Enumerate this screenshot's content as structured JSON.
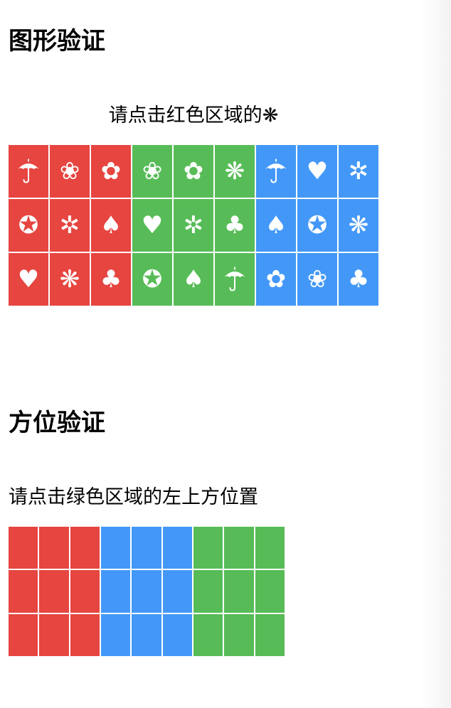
{
  "colors": {
    "red": "#e64540",
    "green": "#57bc57",
    "blue": "#4398f7",
    "glyph": "#ffffff"
  },
  "graphic_verify": {
    "title": "图形验证",
    "prompt_text": "请点击红色区域的",
    "prompt_symbol": "❋",
    "rows": [
      [
        {
          "color": "red",
          "icon": "umbrella-icon",
          "glyph": "☂"
        },
        {
          "color": "red",
          "icon": "flower-icon",
          "glyph": "❀"
        },
        {
          "color": "red",
          "icon": "florette-icon",
          "glyph": "✿"
        },
        {
          "color": "green",
          "icon": "flower-icon",
          "glyph": "❀"
        },
        {
          "color": "green",
          "icon": "florette-icon",
          "glyph": "✿"
        },
        {
          "color": "green",
          "icon": "propeller-asterisk-icon",
          "glyph": "❋"
        },
        {
          "color": "blue",
          "icon": "umbrella-icon",
          "glyph": "☂"
        },
        {
          "color": "blue",
          "icon": "heart-icon",
          "glyph": "♥"
        },
        {
          "color": "blue",
          "icon": "teardrop-asterisk-icon",
          "glyph": "✲"
        }
      ],
      [
        {
          "color": "red",
          "icon": "circled-star-icon",
          "glyph": "✪"
        },
        {
          "color": "red",
          "icon": "teardrop-asterisk-icon",
          "glyph": "✲"
        },
        {
          "color": "red",
          "icon": "spade-icon",
          "glyph": "♠"
        },
        {
          "color": "green",
          "icon": "heart-icon",
          "glyph": "♥"
        },
        {
          "color": "green",
          "icon": "teardrop-asterisk-icon",
          "glyph": "✲"
        },
        {
          "color": "green",
          "icon": "club-icon",
          "glyph": "♣"
        },
        {
          "color": "blue",
          "icon": "spade-icon",
          "glyph": "♠"
        },
        {
          "color": "blue",
          "icon": "circled-star-icon",
          "glyph": "✪"
        },
        {
          "color": "blue",
          "icon": "propeller-asterisk-icon",
          "glyph": "❋"
        }
      ],
      [
        {
          "color": "red",
          "icon": "heart-icon",
          "glyph": "♥"
        },
        {
          "color": "red",
          "icon": "propeller-asterisk-icon",
          "glyph": "❋"
        },
        {
          "color": "red",
          "icon": "club-icon",
          "glyph": "♣"
        },
        {
          "color": "green",
          "icon": "circled-star-icon",
          "glyph": "✪"
        },
        {
          "color": "green",
          "icon": "spade-icon",
          "glyph": "♠"
        },
        {
          "color": "green",
          "icon": "umbrella-icon",
          "glyph": "☂"
        },
        {
          "color": "blue",
          "icon": "florette-icon",
          "glyph": "✿"
        },
        {
          "color": "blue",
          "icon": "flower-icon",
          "glyph": "❀"
        },
        {
          "color": "blue",
          "icon": "club-icon",
          "glyph": "♣"
        }
      ]
    ]
  },
  "position_verify": {
    "title": "方位验证",
    "prompt": "请点击绿色区域的左上方位置",
    "column_colors": [
      "red",
      "red",
      "red",
      "blue",
      "blue",
      "blue",
      "green",
      "green",
      "green"
    ],
    "row_count": 3
  }
}
